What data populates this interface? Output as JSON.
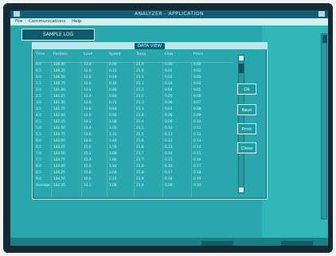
{
  "window": {
    "title": "ANALYZER - APPLICATION",
    "colors": {
      "display_bg": "#1f888b",
      "workspace_bg": "#2aa7ac",
      "accent": "#0f5f78"
    }
  },
  "menubar": {
    "items": [
      "File",
      "Communications",
      "Help"
    ]
  },
  "toolbar": {
    "label": "SAMPLE LOG"
  },
  "subwindow": {
    "title": "DATA VIEW",
    "columns": [
      "Time",
      "Position",
      "Load",
      "Speed",
      "Temp",
      "Flow",
      "Press"
    ],
    "rows": [
      [
        "0.0",
        "100.00",
        "12.4",
        "0.00",
        "21.0",
        "0.00",
        "0.00"
      ],
      [
        "0.5",
        "100.25",
        "12.6",
        "0.12",
        "21.0",
        "0.01",
        "0.02"
      ],
      [
        "1.0",
        "100.50",
        "12.8",
        "0.24",
        "21.1",
        "0.02",
        "0.03"
      ],
      [
        "1.5",
        "100.75",
        "13.0",
        "0.36",
        "21.1",
        "0.03",
        "0.04"
      ],
      [
        "2.0",
        "101.00",
        "13.2",
        "0.48",
        "21.2",
        "0.04",
        "0.05"
      ],
      [
        "2.5",
        "101.25",
        "13.4",
        "0.60",
        "21.2",
        "0.05",
        "0.06"
      ],
      [
        "3.0",
        "101.50",
        "13.6",
        "0.72",
        "21.3",
        "0.06",
        "0.07"
      ],
      [
        "3.5",
        "101.75",
        "13.8",
        "0.84",
        "21.3",
        "0.07",
        "0.08"
      ],
      [
        "4.0",
        "102.00",
        "14.0",
        "0.96",
        "21.4",
        "0.08",
        "0.09"
      ],
      [
        "4.5",
        "102.25",
        "14.2",
        "1.08",
        "21.4",
        "0.09",
        "0.10"
      ],
      [
        "5.0",
        "102.50",
        "14.4",
        "1.20",
        "21.5",
        "0.10",
        "0.11"
      ],
      [
        "5.5",
        "102.75",
        "14.6",
        "1.32",
        "21.5",
        "0.11",
        "0.12"
      ],
      [
        "6.0",
        "103.00",
        "14.8",
        "1.44",
        "21.6",
        "0.12",
        "0.13"
      ],
      [
        "6.5",
        "103.25",
        "15.0",
        "1.56",
        "21.6",
        "0.13",
        "0.14"
      ],
      [
        "7.0",
        "103.50",
        "15.2",
        "1.68",
        "21.7",
        "0.14",
        "0.15"
      ],
      [
        "7.5",
        "103.75",
        "15.4",
        "1.80",
        "21.7",
        "0.15",
        "0.16"
      ],
      [
        "8.0",
        "104.00",
        "15.6",
        "1.92",
        "21.8",
        "0.16",
        "0.17"
      ],
      [
        "8.5",
        "104.25",
        "15.8",
        "2.04",
        "21.8",
        "0.17",
        "0.18"
      ],
      [
        "9.0",
        "104.50",
        "16.0",
        "2.16",
        "21.9",
        "0.18",
        "0.19"
      ],
      [
        "Average",
        "102.25",
        "14.2",
        "1.08",
        "21.4",
        "0.09",
        "0.10"
      ]
    ]
  },
  "buttons": {
    "a": "Ok",
    "b": "Next",
    "c": "Print",
    "d": "Close"
  }
}
